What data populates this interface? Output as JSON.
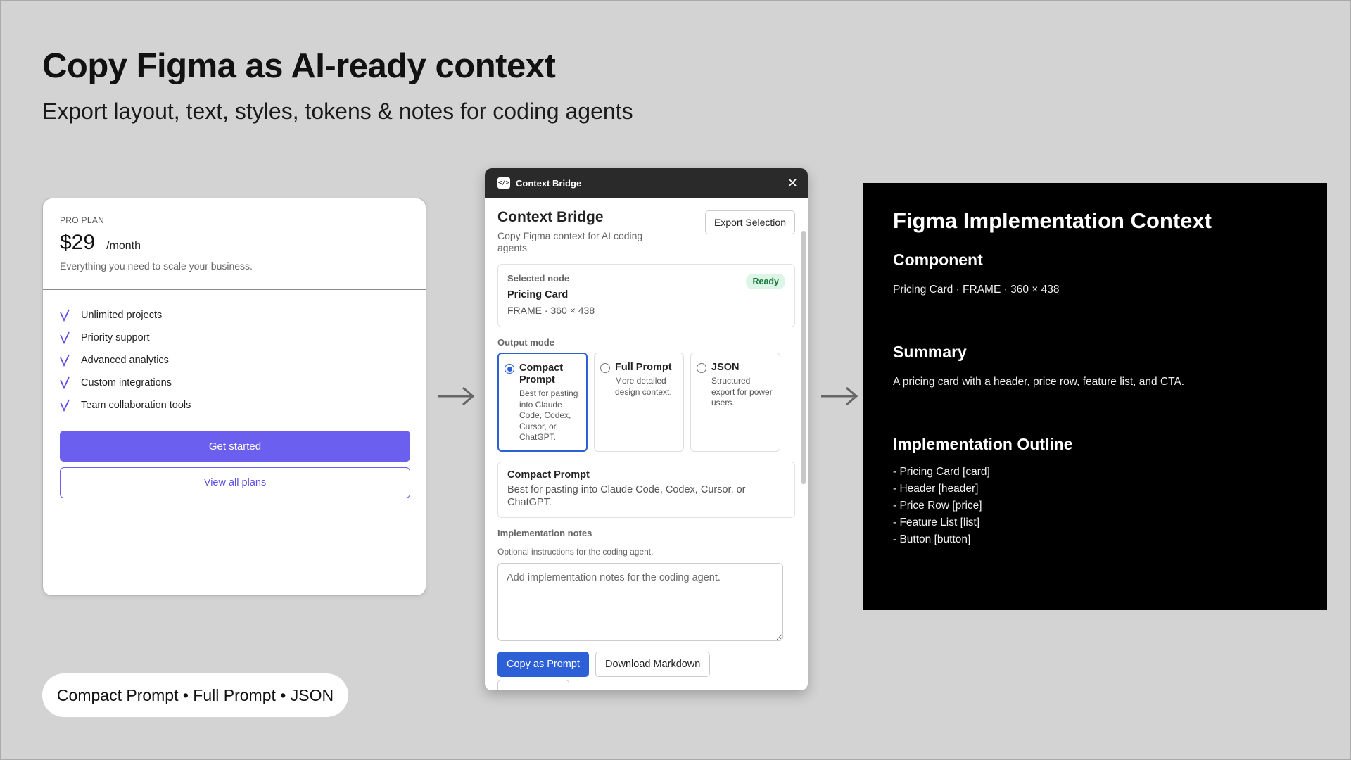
{
  "hero": {
    "title": "Copy Figma as AI-ready context",
    "subtitle": "Export layout, text, styles, tokens & notes for coding agents"
  },
  "pricing_card": {
    "plan": "PRO PLAN",
    "price": "$29",
    "period": "/month",
    "description": "Everything you need to scale your business.",
    "features": [
      "Unlimited projects",
      "Priority support",
      "Advanced analytics",
      "Custom integrations",
      "Team collaboration tools"
    ],
    "cta_label": "Get started",
    "secondary_label": "View all plans",
    "accent_color": "#6b5ff0"
  },
  "plugin": {
    "window_title": "Context Bridge",
    "logo_icon": "code-icon",
    "title": "Context Bridge",
    "subtitle": "Copy Figma context for AI coding agents",
    "export_label": "Export Selection",
    "selected_node": {
      "label": "Selected node",
      "name": "Pricing Card",
      "meta": "FRAME · 360 × 438",
      "status": "Ready"
    },
    "output_mode_label": "Output mode",
    "modes": [
      {
        "title": "Compact Prompt",
        "desc": "Best for pasting into Claude Code, Codex, Cursor, or ChatGPT.",
        "selected": true
      },
      {
        "title": "Full Prompt",
        "desc": "More detailed design context.",
        "selected": false
      },
      {
        "title": "JSON",
        "desc": "Structured export for power users.",
        "selected": false
      }
    ],
    "mode_description": {
      "title": "Compact Prompt",
      "text": "Best for pasting into Claude Code, Codex, Cursor, or ChatGPT."
    },
    "notes": {
      "label": "Implementation notes",
      "help": "Optional instructions for the coding agent.",
      "placeholder": "Add implementation notes for the coding agent.",
      "value": ""
    },
    "copy_label": "Copy as Prompt",
    "download_label": "Download Markdown",
    "accent_color": "#2d5fd6"
  },
  "output": {
    "title": "Figma Implementation Context",
    "component_heading": "Component",
    "component_text": "Pricing Card · FRAME · 360 × 438",
    "summary_heading": "Summary",
    "summary_text": "A pricing card with a header, price row, feature list, and CTA.",
    "outline_heading": "Implementation Outline",
    "outline": [
      "- Pricing Card [card]",
      "- Header [header]",
      "- Price Row [price]",
      "- Feature List [list]",
      "- Button [button]"
    ]
  },
  "pill": {
    "text": "Compact Prompt • Full Prompt • JSON"
  }
}
